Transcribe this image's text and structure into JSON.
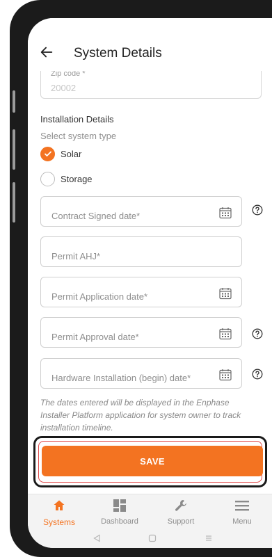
{
  "header": {
    "title": "System Details"
  },
  "zip": {
    "label": "Zip code *",
    "value": "20002"
  },
  "installation": {
    "section_title": "Installation Details",
    "select_label": "Select system type",
    "options": [
      {
        "label": "Solar",
        "checked": true
      },
      {
        "label": "Storage",
        "checked": false
      }
    ]
  },
  "fields": {
    "contract_signed": "Contract Signed date*",
    "permit_ahj": "Permit AHJ*",
    "permit_application": "Permit Application date*",
    "permit_approval": "Permit Approval date*",
    "hardware_installation": "Hardware Installation (begin) date*"
  },
  "note": "The dates entered will be displayed in the Enphase Installer Platform application for system owner to track installation timeline.",
  "save_label": "SAVE",
  "nav": {
    "systems": "Systems",
    "dashboard": "Dashboard",
    "support": "Support",
    "menu": "Menu"
  },
  "colors": {
    "accent": "#f37321",
    "highlight": "#e14848"
  }
}
